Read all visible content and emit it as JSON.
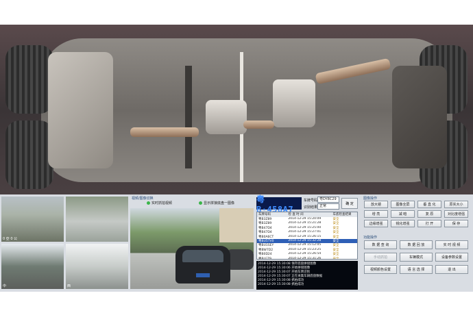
{
  "video_panel": {
    "title": "视频/图像切换",
    "option_realtime": "实时抓拍视频",
    "option_stitched": "显示拼接底盘一图像"
  },
  "cameras": [
    {
      "stamp": "0 亞 0 公"
    },
    {
      "stamp": ""
    },
    {
      "stamp": "中"
    },
    {
      "stamp": "西"
    }
  ],
  "plate": {
    "display": "粤B·458A7",
    "plate_label": "车牌号码",
    "plate_value": "粤DY8C29",
    "state_label": "识别结果",
    "state_value": "正常",
    "confirm": "确 定"
  },
  "record_table": {
    "headers": [
      "车牌号码",
      "检 查 时 间",
      "车底检查结果"
    ],
    "rows": [
      [
        "粤B3Z89",
        "2014-12-29 15:20:09",
        "安全"
      ],
      [
        "粤B3Z89",
        "2014-12-29 15:21:28",
        "安全"
      ],
      [
        "粤B47D4",
        "2014-12-29 15:25:00",
        "安全"
      ],
      [
        "粤B47D4",
        "2014-12-29 15:27:01",
        "安全"
      ],
      [
        "粤B0A6CT",
        "2014-12-29 15:26:15",
        "安全"
      ],
      [
        "粤BU5TV0",
        "2014-12-29 15:32:28",
        "安全"
      ],
      [
        "粤BU1SEY",
        "2014-12-29 15:12:05",
        "安全"
      ],
      [
        "粤BW7D2",
        "2014-12-29 15:23:25",
        "安全"
      ],
      [
        "粤B0D24",
        "2014-12-29 15:26:54",
        "安全"
      ],
      [
        "粤BLEZ9",
        "2014-12-29 15:31:26",
        "安全"
      ]
    ],
    "selected_index": 5
  },
  "log": [
    "2014-12-29 15:30:08   保存底盘拼接图像",
    "2014-12-29 15:30:06   开始拼接图像",
    "2014-12-29 15:30:07   开始车牌识别",
    "2014-12-29 15:30:07   正在采集车辆底盘数据",
    "2014-12-29 15:30:08   抓拍成功",
    "2014-12-29 15:30:08   抓拍成功"
  ],
  "image_ops": {
    "title": "图像操作",
    "buttons": [
      "放大镜",
      "图像全屏",
      "垂 直 化",
      "原实大小",
      "增 亮",
      "减 暗",
      "复 原",
      "对比度增强",
      "边缘增强",
      "锐化增强",
      "打 开",
      "保 存"
    ]
  },
  "func_ops": {
    "title": "功能操作",
    "buttons": [
      "数 据 查 询",
      "数 据 回 放",
      "实 时 视 频",
      "手动抓拍",
      "车辆模式",
      "设备参数设置",
      "视频颜色设置",
      "语 言 选 择",
      "退 出"
    ]
  }
}
